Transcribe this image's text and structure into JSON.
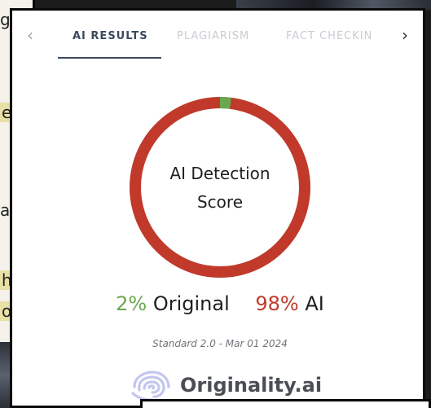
{
  "tabs": {
    "prev_arrow": "‹",
    "next_arrow": "›",
    "items": [
      {
        "label": "AI RESULTS",
        "active": true
      },
      {
        "label": "PLAGIARISM",
        "active": false
      },
      {
        "label": "FACT CHECKIN",
        "active": false
      }
    ]
  },
  "gauge": {
    "title_line1": "AI Detection",
    "title_line2": "Score",
    "original_pct": 2,
    "ai_pct": 98,
    "colors": {
      "original": "#6aa84f",
      "ai": "#c0392b"
    }
  },
  "scores": {
    "original_value": "2%",
    "original_label": "Original",
    "ai_value": "98%",
    "ai_label": "AI"
  },
  "meta": {
    "version_date": "Standard 2.0 - Mar 01 2024"
  },
  "brand": {
    "name": "Originality.ai",
    "logo_icon": "fingerprint-icon"
  },
  "background": {
    "snippets": [
      "gh",
      "e",
      "ar",
      "he",
      "of"
    ]
  }
}
